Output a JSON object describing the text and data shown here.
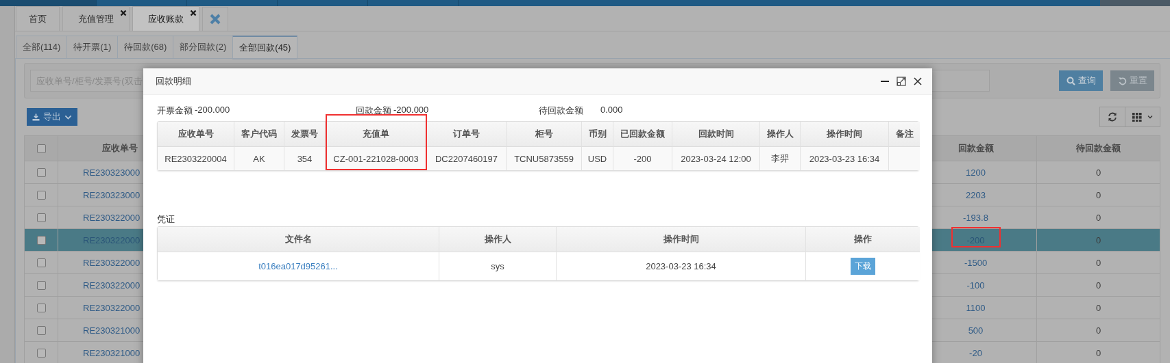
{
  "top_tabs": [
    {
      "label": "首页",
      "closable": false,
      "selected": false
    },
    {
      "label": "充值管理",
      "closable": true,
      "selected": false
    },
    {
      "label": "应收账款",
      "closable": true,
      "selected": true
    }
  ],
  "status_tabs": [
    {
      "label": "全部(114)",
      "selected": false
    },
    {
      "label": "待开票(1)",
      "selected": false
    },
    {
      "label": "待回款(68)",
      "selected": false
    },
    {
      "label": "部分回款(2)",
      "selected": false
    },
    {
      "label": "全部回款(45)",
      "selected": true
    }
  ],
  "search": {
    "placeholder": "应收单号/柜号/发票号(双击"
  },
  "search_buttons": [
    {
      "label": "查询",
      "kind": "query"
    },
    {
      "label": "重置",
      "kind": "reset"
    }
  ],
  "export_button": {
    "label": "导出"
  },
  "table": {
    "header_checkbox": {
      "checked": false
    },
    "columns": [
      {
        "label": "应收单号"
      },
      {
        "label": "回款金额"
      },
      {
        "label": "待回款金额"
      }
    ],
    "rows": [
      {
        "checked": false,
        "selected": false,
        "highlighted": false,
        "receivable_no": "RE230323000",
        "received_amount": "1200",
        "pending_amount": "0"
      },
      {
        "checked": false,
        "selected": false,
        "highlighted": false,
        "receivable_no": "RE230323000",
        "received_amount": "2203",
        "pending_amount": "0"
      },
      {
        "checked": false,
        "selected": false,
        "highlighted": false,
        "receivable_no": "RE230322000",
        "received_amount": "-193.8",
        "pending_amount": "0"
      },
      {
        "checked": false,
        "selected": true,
        "highlighted": true,
        "receivable_no": "RE230322000",
        "received_amount": "-200",
        "pending_amount": "0"
      },
      {
        "checked": false,
        "selected": false,
        "highlighted": false,
        "receivable_no": "RE230322000",
        "received_amount": "-1500",
        "pending_amount": "0"
      },
      {
        "checked": false,
        "selected": false,
        "highlighted": false,
        "receivable_no": "RE230322000",
        "received_amount": "-100",
        "pending_amount": "0"
      },
      {
        "checked": false,
        "selected": false,
        "highlighted": false,
        "receivable_no": "RE230322000",
        "received_amount": "1100",
        "pending_amount": "0"
      },
      {
        "checked": false,
        "selected": false,
        "highlighted": false,
        "receivable_no": "RE230321000",
        "received_amount": "500",
        "pending_amount": "0"
      },
      {
        "checked": false,
        "selected": false,
        "highlighted": false,
        "receivable_no": "RE230321000",
        "received_amount": "-20",
        "pending_amount": "0"
      }
    ]
  },
  "dialog": {
    "title": "回款明细",
    "summary": [
      {
        "label": "开票金额",
        "value": "-200.000"
      },
      {
        "label": "回款金额",
        "value": "-200.000"
      },
      {
        "label": "待回款金额",
        "value": "0.000"
      }
    ],
    "detail_table": {
      "columns": [
        {
          "label": "应收单号",
          "highlighted": false
        },
        {
          "label": "客户代码",
          "highlighted": false
        },
        {
          "label": "发票号",
          "highlighted": false
        },
        {
          "label": "充值单",
          "highlighted": true
        },
        {
          "label": "订单号",
          "highlighted": false
        },
        {
          "label": "柜号",
          "highlighted": false
        },
        {
          "label": "币别",
          "highlighted": false
        },
        {
          "label": "已回款金额",
          "highlighted": false
        },
        {
          "label": "回款时间",
          "highlighted": false
        },
        {
          "label": "操作人",
          "highlighted": false
        },
        {
          "label": "操作时间",
          "highlighted": false
        },
        {
          "label": "备注",
          "highlighted": false
        }
      ],
      "rows": [
        [
          "RE2303220004",
          "AK",
          "354",
          "CZ-001-221028-0003",
          "DC2207460197",
          "TCNU5873559",
          "USD",
          "-200",
          "2023-03-24 12:00",
          "李羿",
          "2023-03-23 16:34"
        ]
      ]
    },
    "voucher": {
      "label": "凭证",
      "columns": [
        {
          "label": "文件名"
        },
        {
          "label": "操作人"
        },
        {
          "label": "操作时间"
        },
        {
          "label": "操作"
        }
      ],
      "rows": [
        {
          "file_name": "t016ea017d95261...",
          "operator": "sys",
          "time": "2023-03-23 16:34",
          "action": "下载"
        }
      ]
    }
  }
}
